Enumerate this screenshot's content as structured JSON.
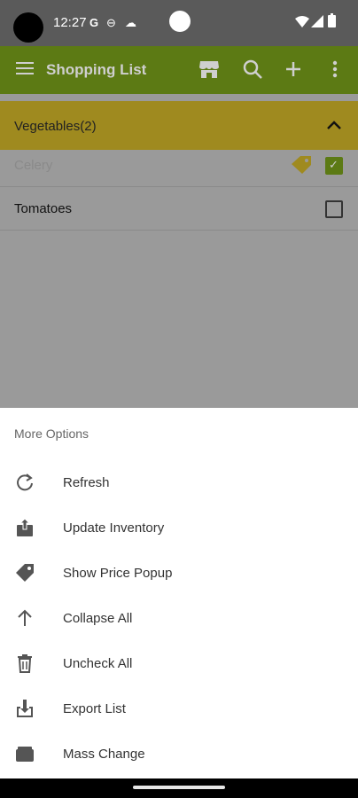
{
  "status_bar": {
    "time": "12:27",
    "icons": [
      "google-icon",
      "dnd-icon",
      "cloud-icon",
      "wifi-icon",
      "signal-icon",
      "battery-icon"
    ]
  },
  "app_bar": {
    "title": "Shopping List",
    "actions": [
      "store-icon",
      "search-icon",
      "add-icon",
      "more-vert-icon"
    ]
  },
  "list": {
    "group": {
      "title": "Vegetables(2)",
      "expanded": true
    },
    "items": [
      {
        "label": "Celery",
        "checked": true,
        "has_price_tag": true
      },
      {
        "label": "Tomatoes",
        "checked": false,
        "has_price_tag": false
      }
    ]
  },
  "sheet": {
    "title": "More Options",
    "options": [
      {
        "label": "Refresh",
        "icon": "refresh-icon"
      },
      {
        "label": "Update Inventory",
        "icon": "upload-icon"
      },
      {
        "label": "Show Price Popup",
        "icon": "price-tag-icon"
      },
      {
        "label": "Collapse All",
        "icon": "arrow-up-icon"
      },
      {
        "label": "Uncheck All",
        "icon": "trash-icon"
      },
      {
        "label": "Export List",
        "icon": "download-icon"
      },
      {
        "label": "Mass Change",
        "icon": "layers-icon"
      }
    ]
  },
  "colors": {
    "appbar": "#5c7a14",
    "group_header": "#9f8a1f",
    "scrim": "#9a9a9a",
    "sheet": "#ffffff"
  }
}
